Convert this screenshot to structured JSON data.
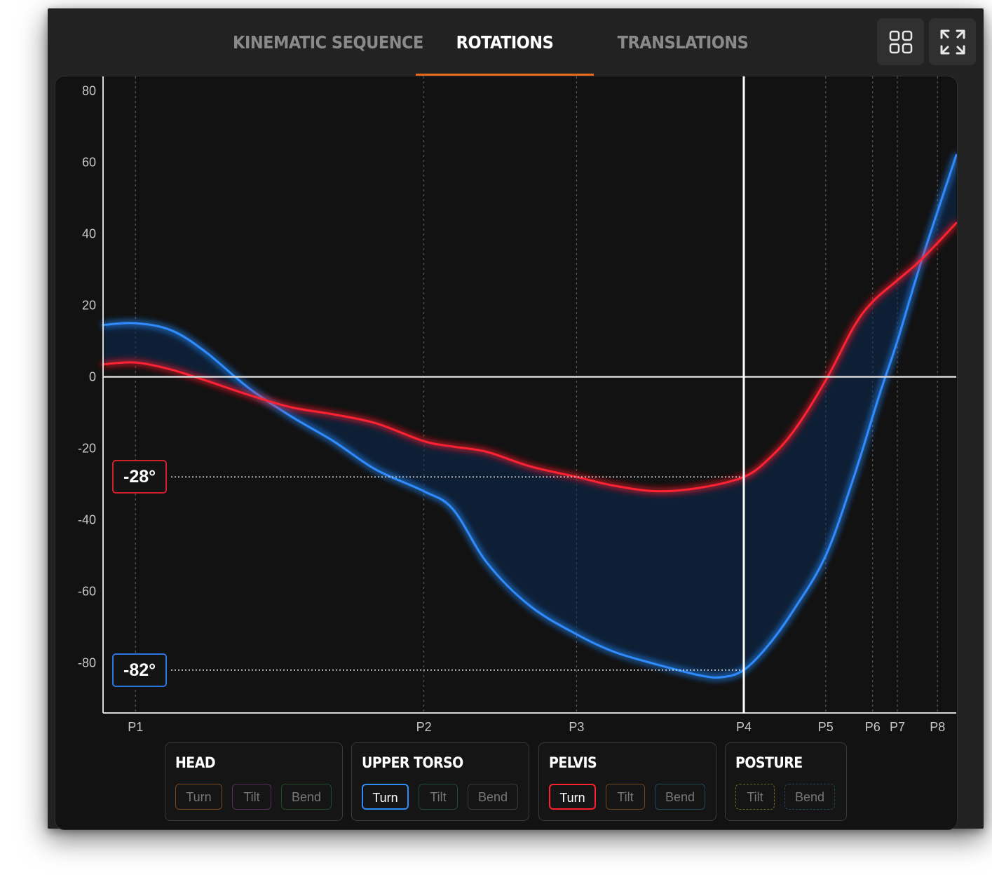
{
  "tabs": [
    {
      "label": "KINEMATIC SEQUENCE",
      "active": false
    },
    {
      "label": "ROTATIONS",
      "active": true
    },
    {
      "label": "TRANSLATIONS",
      "active": false
    }
  ],
  "toolbar": {
    "grid_icon": "grid-icon",
    "expand_icon": "expand-icon"
  },
  "accent_color": "#e86a1a",
  "markers": {
    "upper_torso": "-82°",
    "pelvis": "-28°"
  },
  "legend": [
    {
      "title": "HEAD",
      "chips": [
        {
          "label": "Turn",
          "on": false,
          "color": "#7a4a22",
          "dashed": false
        },
        {
          "label": "Tilt",
          "on": false,
          "color": "#5a2e5e",
          "dashed": false
        },
        {
          "label": "Bend",
          "on": false,
          "color": "#1f4a2a",
          "dashed": false
        }
      ]
    },
    {
      "title": "UPPER TORSO",
      "chips": [
        {
          "label": "Turn",
          "on": true,
          "color": "#2f8cff",
          "dashed": false
        },
        {
          "label": "Tilt",
          "on": false,
          "color": "#1f4a40",
          "dashed": false
        },
        {
          "label": "Bend",
          "on": false,
          "color": "#3a3a3a",
          "dashed": false
        }
      ]
    },
    {
      "title": "PELVIS",
      "chips": [
        {
          "label": "Turn",
          "on": true,
          "color": "#ff2030",
          "dashed": false
        },
        {
          "label": "Tilt",
          "on": false,
          "color": "#6a4a1e",
          "dashed": false
        },
        {
          "label": "Bend",
          "on": false,
          "color": "#1f4a55",
          "dashed": false
        }
      ]
    },
    {
      "title": "POSTURE",
      "chips": [
        {
          "label": "Tilt",
          "on": false,
          "color": "#6a6a20",
          "dashed": true
        },
        {
          "label": "Bend",
          "on": false,
          "color": "#1f4a55",
          "dashed": true
        }
      ]
    }
  ],
  "chart_data": {
    "type": "line",
    "ylim": [
      -94,
      84
    ],
    "yticks": [
      80,
      60,
      40,
      20,
      0,
      -20,
      -40,
      -60,
      -80
    ],
    "xlim": [
      0,
      100
    ],
    "positions": [
      {
        "label": "P1",
        "x": 3.8
      },
      {
        "label": "P2",
        "x": 37.6
      },
      {
        "label": "P3",
        "x": 55.5
      },
      {
        "label": "P4",
        "x": 75.1
      },
      {
        "label": "P5",
        "x": 84.7
      },
      {
        "label": "P6",
        "x": 90.2
      },
      {
        "label": "P7",
        "x": 93.1
      },
      {
        "label": "P8",
        "x": 97.8
      }
    ],
    "cursor_x": 75.1,
    "series": [
      {
        "name": "Upper Torso Turn",
        "color": "#2f8cff",
        "x": [
          0,
          3.8,
          8,
          12,
          17,
          22,
          27,
          32,
          37.6,
          41,
          45,
          50,
          55.5,
          60,
          65,
          70,
          72.5,
          75.1,
          78,
          81,
          84.7,
          88,
          91,
          93.1,
          96,
          100
        ],
        "y": [
          14.5,
          15,
          13,
          7,
          -3,
          -11,
          -18,
          -26,
          -32,
          -37,
          -52,
          -64,
          -72,
          -77,
          -80.5,
          -83.5,
          -84,
          -82,
          -75,
          -65,
          -50,
          -28,
          -5,
          10,
          33,
          62
        ]
      },
      {
        "name": "Pelvis Turn",
        "color": "#ff2030",
        "x": [
          0,
          3.8,
          8,
          12,
          17,
          22,
          27,
          32,
          37.6,
          41,
          45,
          50,
          55.5,
          60,
          65,
          70,
          75.1,
          78,
          81,
          84.7,
          88,
          90.2,
          93.1,
          96,
          100
        ],
        "y": [
          3.5,
          4,
          2,
          -1,
          -5,
          -8.5,
          -10.5,
          -13,
          -18,
          -19.5,
          -21,
          -25,
          -28,
          -30.5,
          -32,
          -31,
          -28,
          -23,
          -15,
          -1,
          14,
          21,
          27,
          33,
          43
        ]
      }
    ]
  }
}
